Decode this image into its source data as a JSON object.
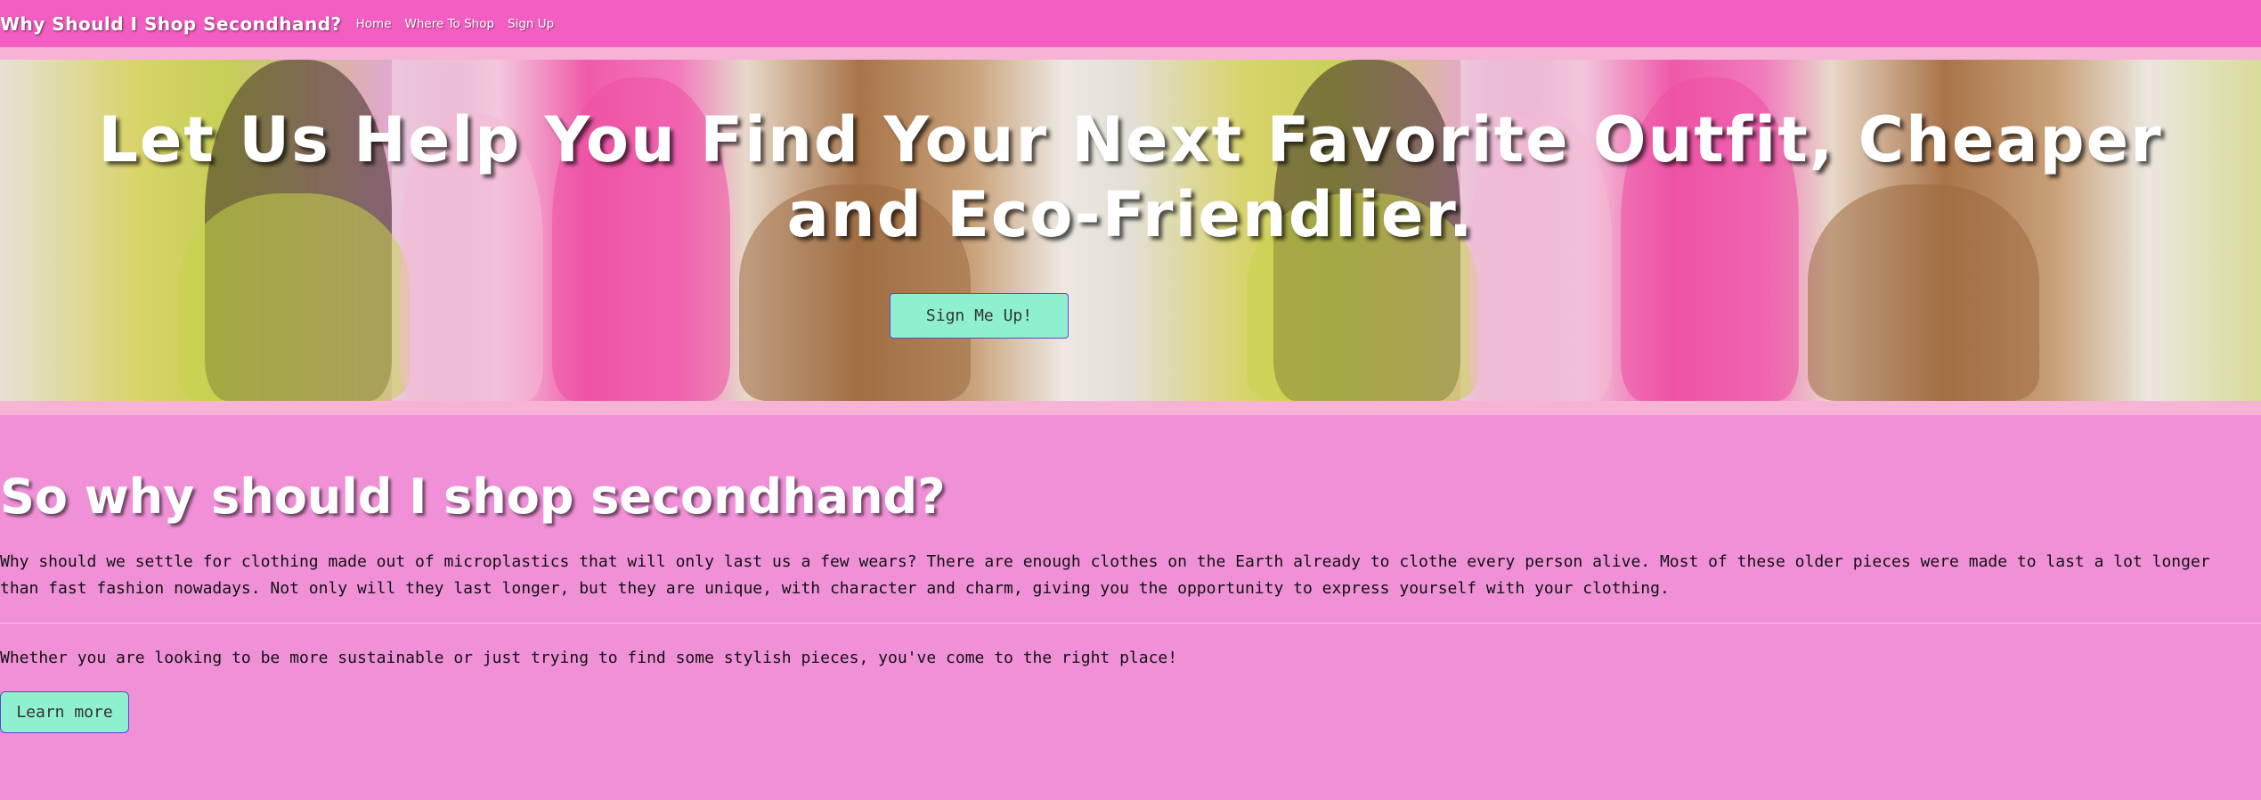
{
  "navbar": {
    "brand": "Why Should I Shop Secondhand?",
    "links": [
      {
        "label": "Home"
      },
      {
        "label": "Where To Shop"
      },
      {
        "label": "Sign Up"
      }
    ]
  },
  "hero": {
    "title": "Let Us Help You Find Your Next Favorite Outfit, Cheaper and Eco-Friendlier.",
    "button_label": "Sign Me Up!"
  },
  "main": {
    "heading": "So why should I shop secondhand?",
    "paragraph_1": "Why should we settle for clothing made out of microplastics that will only last us a few wears? There are enough clothes on the Earth already to clothe every person alive. Most of these older pieces were made to last a lot longer than fast fashion nowadays. Not only will they last longer, but they are unique, with character and charm, giving you the opportunity to express yourself with your clothing.",
    "paragraph_2": "Whether you are looking to be more sustainable or just trying to find some stylish pieces, you've come to the right place!",
    "button_label": "Learn more"
  },
  "colors": {
    "navbar_bg": "#f25ec2",
    "page_bg": "#f091d8",
    "button_bg": "#8ef0cf",
    "button_border": "#6a3fd6"
  }
}
